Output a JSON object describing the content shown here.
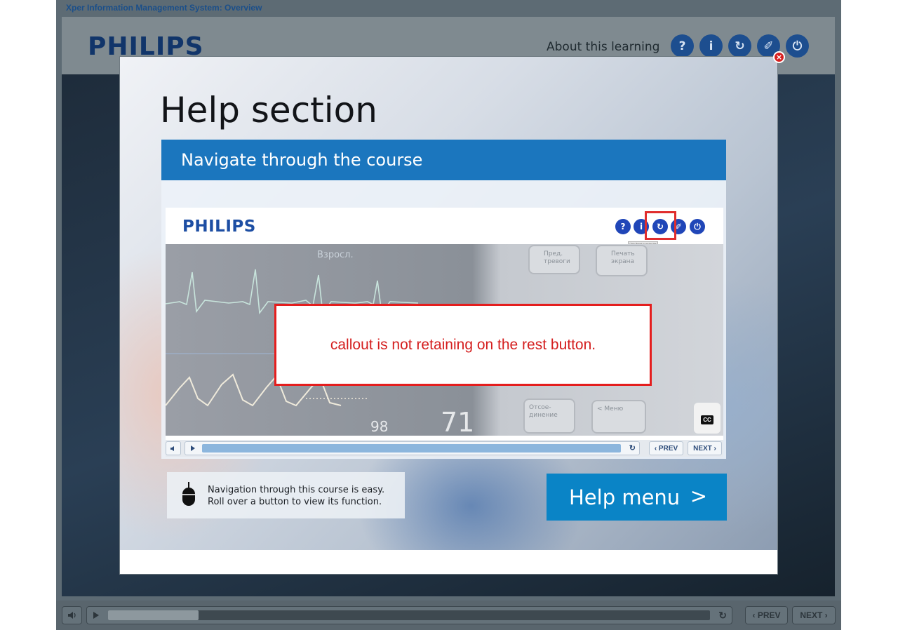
{
  "app": {
    "window_title": "Xper Information Management System: Overview",
    "logo": "PHILIPS",
    "about_link": "About this learning",
    "header_buttons": [
      {
        "name": "help-icon",
        "glyph": "?"
      },
      {
        "name": "info-icon",
        "glyph": "i"
      },
      {
        "name": "reset-icon",
        "glyph": "↻"
      },
      {
        "name": "pen-icon",
        "glyph": "✐"
      },
      {
        "name": "power-icon",
        "glyph": "⏻"
      }
    ],
    "controls": {
      "prev_label": "‹ PREV",
      "next_label": "NEXT ›",
      "progress": 0.15
    }
  },
  "modal": {
    "close_glyph": "×",
    "title": "Help section",
    "section_header": "Navigate through the course",
    "demo": {
      "logo": "PHILIPS",
      "buttons": [
        {
          "name": "help-icon",
          "glyph": "?"
        },
        {
          "name": "info-icon",
          "glyph": "i"
        },
        {
          "name": "reset-icon",
          "glyph": "↻"
        },
        {
          "name": "pen-icon",
          "glyph": "✐"
        },
        {
          "name": "power-icon",
          "glyph": "⏻"
        }
      ],
      "tooltip": "Click Reset to restart the course.",
      "monitor_label": "Взросл.",
      "monitor_value_a": "98",
      "monitor_value_b": "71",
      "panel_keys": [
        "Пред. тревоги",
        "Печать экрана",
        "Отсое-динение",
        "< Меню"
      ],
      "cc_label": "CC",
      "prev_label": "‹ PREV",
      "next_label": "NEXT ›"
    },
    "callout": "callout is not retaining on the rest button.",
    "tip_line1": "Navigation through this course is easy.",
    "tip_line2": "Roll over a button to view its function.",
    "help_menu_label": "Help menu",
    "help_menu_arrow": ">"
  }
}
